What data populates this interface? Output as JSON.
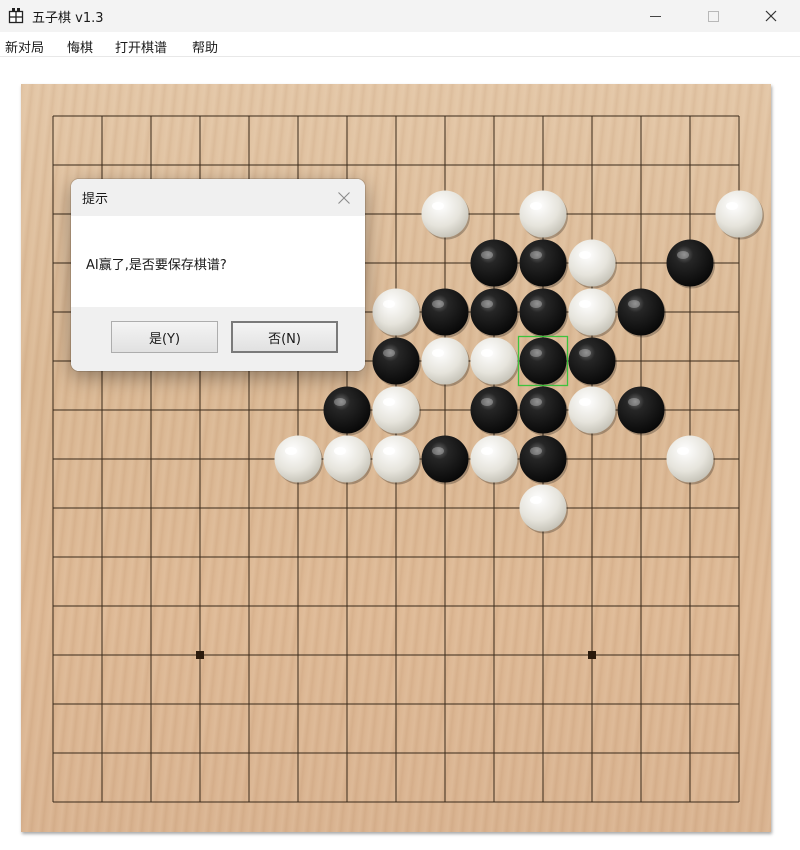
{
  "window": {
    "title": "五子棋 v1.3",
    "icon": "gomoku-app-icon"
  },
  "menu": {
    "items": [
      "新对局",
      "悔棋",
      "打开棋谱",
      "帮助"
    ]
  },
  "board": {
    "size": 15,
    "star_points": [
      [
        3,
        11
      ],
      [
        11,
        11
      ]
    ],
    "last_move": [
      10,
      5
    ],
    "last_move_color": "#3ec23e",
    "stones": [
      {
        "col": 8,
        "row": 2,
        "color": "white"
      },
      {
        "col": 10,
        "row": 2,
        "color": "white"
      },
      {
        "col": 14,
        "row": 2,
        "color": "white"
      },
      {
        "col": 9,
        "row": 3,
        "color": "black"
      },
      {
        "col": 10,
        "row": 3,
        "color": "black"
      },
      {
        "col": 11,
        "row": 3,
        "color": "white"
      },
      {
        "col": 13,
        "row": 3,
        "color": "black"
      },
      {
        "col": 7,
        "row": 4,
        "color": "white"
      },
      {
        "col": 8,
        "row": 4,
        "color": "black"
      },
      {
        "col": 9,
        "row": 4,
        "color": "black"
      },
      {
        "col": 10,
        "row": 4,
        "color": "black"
      },
      {
        "col": 11,
        "row": 4,
        "color": "white"
      },
      {
        "col": 12,
        "row": 4,
        "color": "black"
      },
      {
        "col": 7,
        "row": 5,
        "color": "black"
      },
      {
        "col": 8,
        "row": 5,
        "color": "white"
      },
      {
        "col": 9,
        "row": 5,
        "color": "white"
      },
      {
        "col": 10,
        "row": 5,
        "color": "black"
      },
      {
        "col": 11,
        "row": 5,
        "color": "black"
      },
      {
        "col": 6,
        "row": 6,
        "color": "black"
      },
      {
        "col": 7,
        "row": 6,
        "color": "white"
      },
      {
        "col": 9,
        "row": 6,
        "color": "black"
      },
      {
        "col": 10,
        "row": 6,
        "color": "black"
      },
      {
        "col": 11,
        "row": 6,
        "color": "white"
      },
      {
        "col": 12,
        "row": 6,
        "color": "black"
      },
      {
        "col": 5,
        "row": 7,
        "color": "white"
      },
      {
        "col": 6,
        "row": 7,
        "color": "white"
      },
      {
        "col": 7,
        "row": 7,
        "color": "white"
      },
      {
        "col": 8,
        "row": 7,
        "color": "black"
      },
      {
        "col": 9,
        "row": 7,
        "color": "white"
      },
      {
        "col": 10,
        "row": 7,
        "color": "black"
      },
      {
        "col": 13,
        "row": 7,
        "color": "white"
      },
      {
        "col": 10,
        "row": 8,
        "color": "white"
      }
    ]
  },
  "dialog": {
    "title": "提示",
    "message": "AI赢了,是否要保存棋谱?",
    "yes_label": "是(Y)",
    "no_label": "否(N)"
  },
  "colors": {
    "grid_line": "#3a2a1a",
    "board_wood": "#dcb995",
    "highlight": "#3ec23e"
  }
}
